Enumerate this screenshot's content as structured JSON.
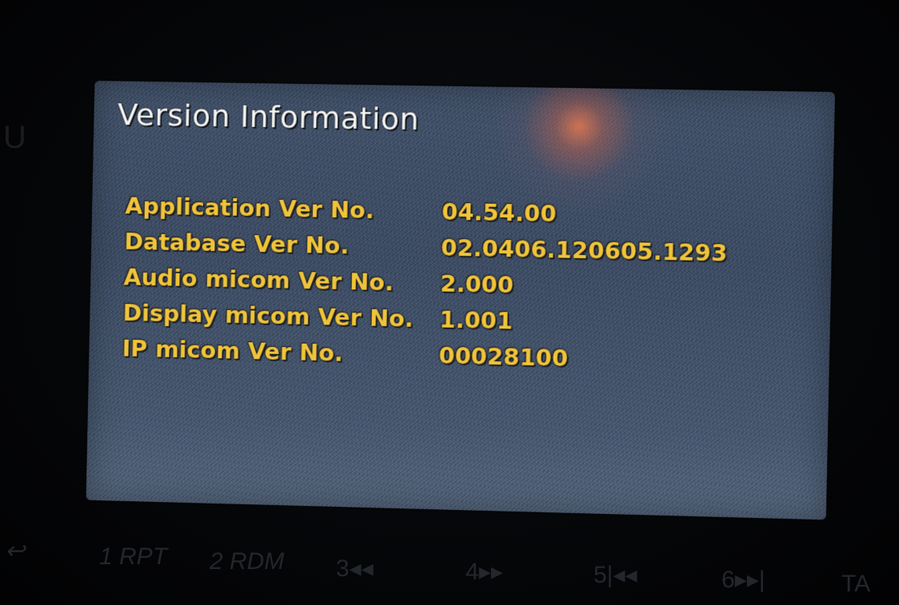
{
  "screen": {
    "title": "Version Information",
    "rows": [
      {
        "label": "Application Ver No.",
        "value": "04.54.00"
      },
      {
        "label": "Database Ver No.",
        "value": "02.0406.120605.1293"
      },
      {
        "label": "Audio micom Ver No.",
        "value": "2.000"
      },
      {
        "label": "Display micom Ver No.",
        "value": "1.001"
      },
      {
        "label": "IP micom Ver No.",
        "value": "00028100"
      }
    ]
  },
  "hardware_buttons": {
    "back": "↩",
    "b1": "1 RPT",
    "b2": "2 RDM",
    "b3": "3◂◂",
    "b4": "4▸▸",
    "b5": "5|◂◂",
    "b6": "6▸▸|",
    "ta": "TA"
  },
  "colors": {
    "label_text": "#f0c43a",
    "title_text": "#f4f4f2",
    "screen_bg": "#3a4a62"
  }
}
